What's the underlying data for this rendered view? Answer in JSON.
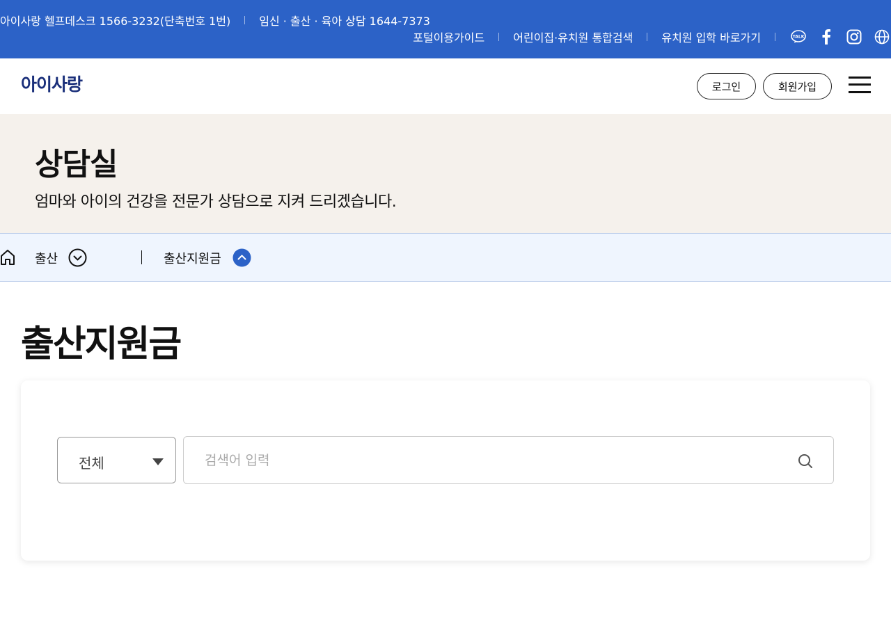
{
  "topbar": {
    "helpdesk": "아이사랑 헬프데스크 1566-3232(단축번호 1번)",
    "counsel": "임신 · 출산 · 육아 상담 1644-7373",
    "links": [
      "포털이용가이드",
      "어린이집·유치원 통합검색",
      "유치원 입학 바로가기"
    ],
    "social_icons": [
      "kakaotalk-icon",
      "facebook-icon",
      "instagram-icon",
      "globe-icon"
    ],
    "bg_color": "#2c62c7"
  },
  "header": {
    "logo": "아이사랑",
    "login_label": "로그인",
    "join_label": "회원가입"
  },
  "hero": {
    "title": "상담실",
    "subtitle": "엄마와 아이의 건강을 전문가 상담으로 지켜 드리겠습니다."
  },
  "breadcrumb": {
    "level1": "출산",
    "level2": "출산지원금"
  },
  "page": {
    "title": "출산지원금"
  },
  "search": {
    "category_value": "전체",
    "placeholder": "검색어 입력",
    "value": ""
  }
}
